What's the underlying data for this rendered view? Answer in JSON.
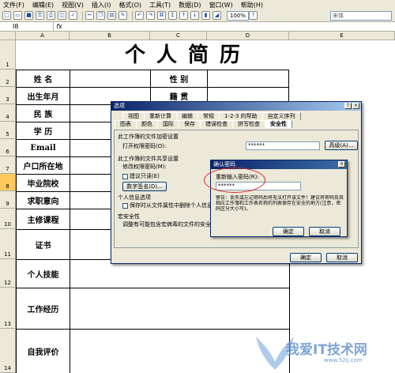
{
  "menu": [
    "文件(F)",
    "编辑(E)",
    "视图(V)",
    "插入(I)",
    "格式(O)",
    "工具(T)",
    "数据(D)",
    "窗口(W)",
    "帮助(H)"
  ],
  "toolbar": {
    "zoom": "100%",
    "font": "宋体"
  },
  "formula_bar": {
    "cell_ref": "I8",
    "fx": "fx"
  },
  "columns": [
    "A",
    "B",
    "C",
    "D",
    "E"
  ],
  "rows": [
    "1",
    "2",
    "3",
    "4",
    "5",
    "6",
    "7",
    "8",
    "9",
    "10",
    "11",
    "12",
    "13",
    "14"
  ],
  "sheet": {
    "title": "个人简历",
    "labels": {
      "name": "姓 名",
      "birth": "出生年月",
      "ethnic": "民 族",
      "edu": "学 历",
      "email": "Email",
      "hukou": "户口所在地",
      "school": "毕业院校",
      "job": "求职意向",
      "course": "主修课程",
      "cert": "证书",
      "skill": "个人技能",
      "work": "工作经历",
      "eval": "自我评价",
      "gender": "性 别",
      "native": "籍 贯"
    }
  },
  "options_dialog": {
    "title": "选项",
    "tabs_row1": [
      "视图",
      "重新计算",
      "编辑",
      "常规",
      "1-2-3 的帮助",
      "自定义序列"
    ],
    "tabs_row2": [
      "图表",
      "颜色",
      "国际",
      "保存",
      "错误检查",
      "拼写检查",
      "安全性"
    ],
    "section1": "此工作簿的文件加密设置",
    "open_pwd_label": "打开权限密码(O):",
    "open_pwd_value": "******",
    "advanced_button": "高级(A)...",
    "section2": "此工作簿的文件共享设置",
    "modify_pwd_label": "修改权限密码(M):",
    "readonly_label": "建议只读(E)",
    "digital_sign_button": "数字签名(D)...",
    "privacy_header": "个人信息选项",
    "privacy_label": "保存时从文件属性中删除个人信息",
    "macro_header": "宏安全性",
    "macro_text": "调整有可能包含宏病毒的文件的安全",
    "ok_button": "确定",
    "cancel_button": "取消"
  },
  "confirm_dialog": {
    "title": "确认密码",
    "label": "重新输入密码(R):",
    "value": "******",
    "warning": "警告：丢失或忘记密码后将无法打开该文件！建议将密码及其相应工作簿和工作表名称的列表保存在安全的地方(注意，密码区分大小写)。",
    "ok_button": "确定",
    "cancel_button": "取消"
  },
  "watermark": {
    "text": "我爱IT技术网",
    "url": "www.52ij.com"
  }
}
